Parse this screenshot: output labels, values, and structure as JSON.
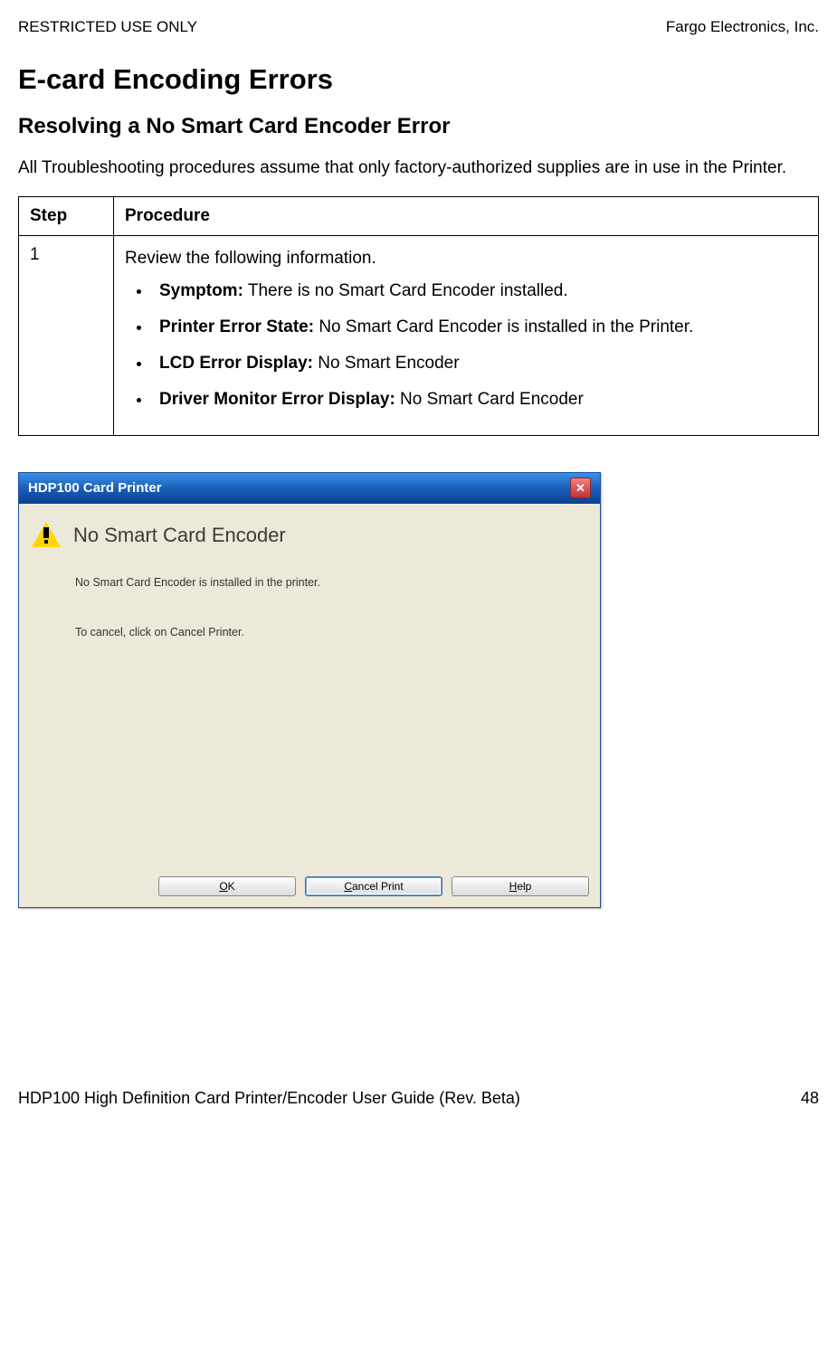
{
  "header": {
    "left": "RESTRICTED USE ONLY",
    "right": "Fargo Electronics, Inc."
  },
  "heading1": "E-card Encoding Errors",
  "heading2": "Resolving a No Smart Card Encoder Error",
  "intro": "All Troubleshooting procedures assume that only factory-authorized supplies are in use in the Printer.",
  "table": {
    "col_step": "Step",
    "col_proc": "Procedure",
    "rows": [
      {
        "step": "1",
        "intro": "Review the following information.",
        "bullets": [
          {
            "label": "Symptom:",
            "text": " There is no Smart Card Encoder installed."
          },
          {
            "label": "Printer Error State:",
            "text": "  No Smart Card Encoder is installed in the Printer."
          },
          {
            "label": "LCD Error Display:",
            "text": "  No Smart Encoder"
          },
          {
            "label": "Driver Monitor Error Display:",
            "text": "  No Smart Card Encoder"
          }
        ]
      }
    ]
  },
  "dialog": {
    "title": "HDP100 Card Printer",
    "heading": "No Smart Card Encoder",
    "line1": "No Smart Card Encoder is installed in the printer.",
    "line2": "To cancel, click on Cancel Printer.",
    "buttons": {
      "ok_u": "O",
      "ok_rest": "K",
      "cancel_u": "C",
      "cancel_rest": "ancel Print",
      "help_u": "H",
      "help_rest": "elp"
    }
  },
  "footer": {
    "left": "HDP100 High Definition Card Printer/Encoder User Guide (Rev. Beta)",
    "right": "48"
  }
}
